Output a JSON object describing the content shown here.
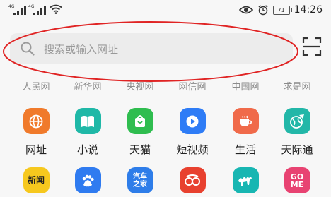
{
  "status_bar": {
    "signal_labels": [
      "4G",
      "4G"
    ],
    "battery": "71",
    "time": "14:26",
    "icons": [
      "signal-icon",
      "signal-icon",
      "wifi-icon",
      "eye-icon",
      "alarm-icon",
      "battery-icon"
    ]
  },
  "search": {
    "placeholder": "搜索或输入网址"
  },
  "quick_links": [
    "人民网",
    "新华网",
    "央视网",
    "网信网",
    "中国网",
    "求是网"
  ],
  "apps_row1": [
    {
      "label": "网址",
      "color": "#f07a2b",
      "icon": "globe-icon"
    },
    {
      "label": "小说",
      "color": "#1fb8a7",
      "icon": "book-icon"
    },
    {
      "label": "天猫",
      "color": "#2fbd4f",
      "icon": "shopping-bag-icon"
    },
    {
      "label": "短视频",
      "color": "#2e7cf6",
      "icon": "play-icon"
    },
    {
      "label": "生活",
      "color": "#f06a4a",
      "icon": "cup-icon"
    },
    {
      "label": "天际通",
      "color": "#22b7a8",
      "icon": "globe-plane-icon"
    }
  ],
  "apps_row2": [
    {
      "text": "新闻",
      "color": "#f6c81e",
      "icon": "news-icon"
    },
    {
      "text": "",
      "color": "#2f7bf0",
      "icon": "baidu-paw-icon"
    },
    {
      "text": "汽车\n之家",
      "color": "#2e7de9",
      "icon": "autohome-icon"
    },
    {
      "text": "",
      "color": "#e8412f",
      "icon": "sina-icon"
    },
    {
      "text": "",
      "color": "#18b6b2",
      "icon": "camel-icon"
    },
    {
      "text": "GO\nME",
      "color": "#e84372",
      "icon": "gome-icon"
    }
  ],
  "colors": {
    "annotation": "#e02424",
    "placeholder": "#9a9a9a",
    "quick_link": "#8b8b8b"
  }
}
